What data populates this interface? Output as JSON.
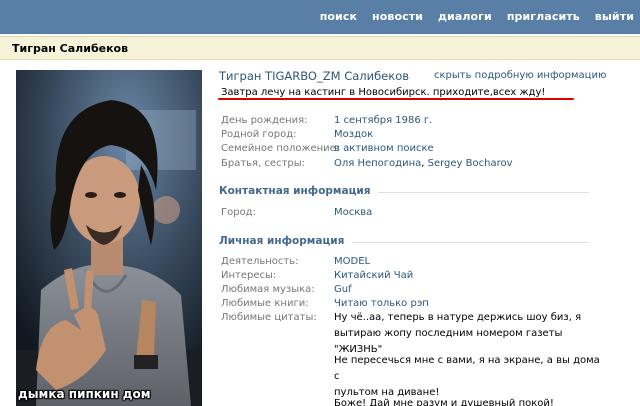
{
  "nav": {
    "items": [
      "поиск",
      "новости",
      "диалоги",
      "пригласить",
      "выйти"
    ]
  },
  "header": {
    "title": "Тигран Салибеков"
  },
  "photo": {
    "caption": "дымка пипкин дом"
  },
  "profile": {
    "name": "Тигран TIGARBO_ZM Салибеков",
    "hide_link": "скрыть подробную информацию",
    "status": "Завтра лечу на кастинг в Новосибирск. приходите,всех жду!"
  },
  "basic": {
    "birthday_label": "День рождения:",
    "birthday_value": "1 сентября 1986 г.",
    "hometown_label": "Родной город:",
    "hometown_value": "Моздок",
    "family_label": "Семейное положение:",
    "family_value": "в активном поиске",
    "siblings_label": "Братья, сестры:",
    "sibling1": "Оля Непогодина",
    "sibling_sep": ", ",
    "sibling2": "Sergey Bocharov"
  },
  "contact": {
    "section_title": "Контактная информация",
    "city_label": "Город:",
    "city_value": "Москва"
  },
  "personal": {
    "section_title": "Личная информация",
    "activity_label": "Деятельность:",
    "activity_value": "MODEL",
    "interests_label": "Интересы:",
    "interests_value": "Китайский Чай",
    "music_label": "Любимая музыка:",
    "music_value": "Guf",
    "books_label": "Любимые книги:",
    "books_value": "Читаю только рэп",
    "quotes_label": "Любимые цитаты:",
    "quote1_line1": "Ну чё..аа, теперь в натуре держись шоу биз, я",
    "quote1_line2": "вытираю жопу последним номером газеты \"ЖИЗНЬ\"",
    "quote2_line1": "Не пересечься мне с вами, я на экране, а вы дома с",
    "quote2_line2": "пультом на диване!",
    "quote3_line1": "Боже! Дай мне разум и душевный покой!"
  },
  "colors": {
    "topbar": "#5a7fa6",
    "link": "#2b587a",
    "section": "#45688e",
    "label": "#777777",
    "underline": "#e00000"
  }
}
